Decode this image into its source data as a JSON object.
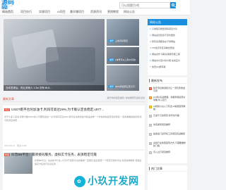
{
  "header": {
    "logo_main": "源码网",
    "logo_sub": "www.xxxxxx.com",
    "search_placeholder": "可以搜题目/吧"
  },
  "nav": [
    "网站首页",
    "项目技巧",
    "实操项目",
    "AI项目",
    "兼学赚项目",
    "资源资讯",
    "营销教程",
    "网站公告"
  ],
  "slider": {
    "caption": "当你发现后，别让其他人 1.3w 次有 lik1t..."
  },
  "thumbs": [
    {
      "tag": "推荐",
      "text": "上本月好项目"
    },
    {
      "tag": "推荐",
      "text": "1本号可以上到10月的..."
    },
    {
      "tag": "推荐",
      "text": "2024年如何让孩子们..."
    }
  ],
  "notice": {
    "title": "网站公告",
    "items": [
      "只收取高质量源码项目分享",
      "网站会员终身不定时更新",
      "所有资源都会在不停网站",
      "VIP会员专区请看这里说",
      "网站合作 请联系客服专属上客",
      "网站支付宝付款方便 在线直付",
      "免费QQ群获取"
    ]
  },
  "announcement": {
    "title": "最新文章",
    "right": "提升你的运营技能 / 前言推荐及最新活动"
  },
  "articles": [
    {
      "badge": "商业",
      "title": "USDT跑平台兑加油卡,利润可高达29%,为卡贩认定会稳定,x977...",
      "text": "对于众多人来说,靠刷卡做USDT的人们都知道这一点,利润可高达29%,跑平台兑换加油卡就是这样一个非常成熟且稳定的项目,一起来看看最新的玩法与利润空间吧……",
      "meta": "2024-06-12  ·  阅读 1128"
    },
    {
      "badge": "教程",
      "title": "抖音BB平台：最新接码服务，虚拟实卡任务，表演稳定可靠",
      "text": "抖音BB平台：在虚拟卡行业,人们对于接码平台的需求一直很高,最近发现一个稳定可靠的平台,支持多种服务,包括虚拟实卡任务与表演任务……",
      "meta": "2024-06-11  ·  阅读 986"
    }
  ],
  "hot": {
    "title": "最新发布",
    "items": [
      "快手专栏精选知识让一流玩家收益可观",
      "从0到1实战教程：海量视频运营全攻略,年入百万",
      "AI视频小白入门玩法,AI赋能变现教程",
      "日进千元的项目,新手也可做",
      "仿真游戏项目推荐",
      "拍卖会门道手机工具项目实战解密",
      "虚拟行业新型变现方式,不需要做粉丝门槛",
      "月入过万项目推荐"
    ]
  },
  "tags_title": "热门文章",
  "watermark": "小玖开发网"
}
